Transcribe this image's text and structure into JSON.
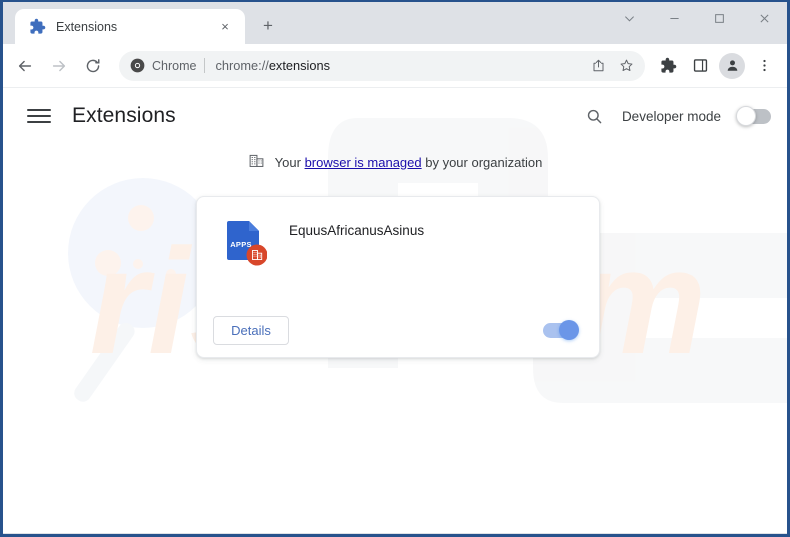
{
  "window": {
    "frame_color": "#27528c",
    "controls": [
      {
        "name": "tab-search-button",
        "glyph": "chevron-down-icon"
      },
      {
        "name": "minimize-button",
        "glyph": "minimize-icon"
      },
      {
        "name": "maximize-button",
        "glyph": "maximize-icon"
      },
      {
        "name": "close-button",
        "glyph": "close-icon"
      }
    ]
  },
  "tabs": [
    {
      "title": "Extensions",
      "favicon": "puzzle-piece-icon",
      "close_label": "×",
      "active": true
    }
  ],
  "newtab": {
    "label": "+"
  },
  "toolbar": {
    "back_label": "←",
    "forward_label": "→",
    "reload_label": "⟳",
    "chrome_chip_label": "Chrome",
    "url_scheme": "chrome://",
    "url_path": "extensions",
    "url_full": "chrome://extensions",
    "icons": [
      {
        "name": "share-icon"
      },
      {
        "name": "bookmark-star-icon"
      },
      {
        "name": "extensions-puzzle-icon"
      },
      {
        "name": "side-panel-icon"
      },
      {
        "name": "profile-avatar-icon"
      },
      {
        "name": "three-dot-menu-icon"
      }
    ]
  },
  "page": {
    "menu_label": "Main menu",
    "title": "Extensions",
    "search_icon": "search-icon",
    "developer_mode": {
      "label": "Developer mode",
      "enabled": false
    },
    "managed_notice": {
      "icon": "enterprise-building-icon",
      "prefix": "Your ",
      "link": "browser is managed",
      "suffix": " by your organization"
    },
    "extension_card": {
      "name": "EquusAfricanusAsinus",
      "icon": {
        "name": "apps-document-icon",
        "label": "APPS",
        "color": "#2f64cd",
        "badge": "enterprise-building-badge",
        "badge_color": "#d8472b"
      },
      "details_button": "Details",
      "enabled": true,
      "toggle_color": "#6b96e8"
    },
    "watermark": {
      "text": "risk.com",
      "logo": "pc-magnifier-logo",
      "color": "#fdf1e9"
    }
  }
}
